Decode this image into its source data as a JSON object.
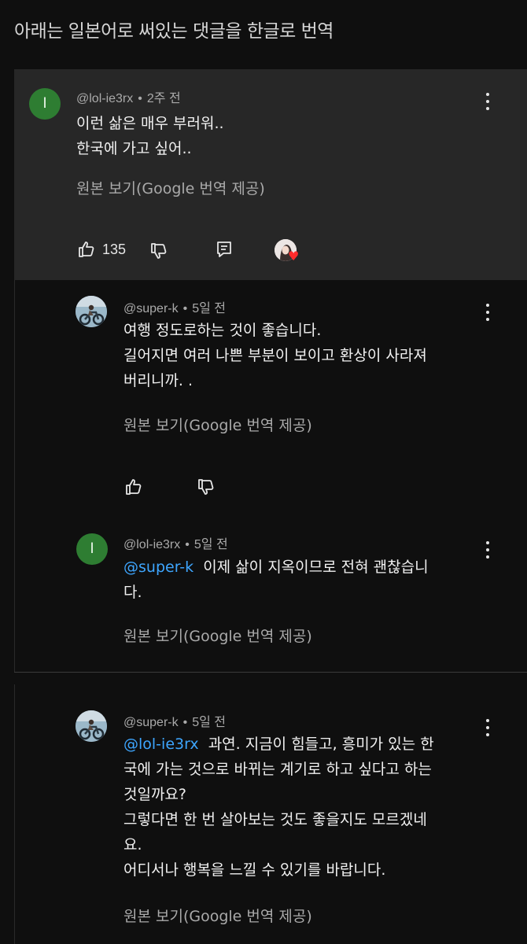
{
  "page": {
    "title": "아래는 일본어로 써있는 댓글을 한글로 번역"
  },
  "comments": [
    {
      "avatar_letter": "I",
      "handle": "@lol-ie3rx",
      "time": "2주 전",
      "lines": [
        "이런 삶은 매우 부러워..",
        "한국에 가고 싶어.."
      ],
      "translate_label": "원본 보기(Google 번역 제공)",
      "likes": "135"
    },
    {
      "handle": "@super-k",
      "time": "5일 전",
      "lines": [
        "여행 정도로하는 것이 좋습니다.",
        "길어지면 여러 나쁜 부분이 보이고 환상이 사라져",
        "버리니까. ."
      ],
      "translate_label": "원본 보기(Google 번역 제공)"
    },
    {
      "avatar_letter": "I",
      "handle": "@lol-ie3rx",
      "time": "5일 전",
      "mention": "@super-k",
      "line1": "이제 삶이 지옥이므로 전혀 괜찮습니",
      "line2": "다.",
      "translate_label": "원본 보기(Google 번역 제공)"
    },
    {
      "handle": "@super-k",
      "time": "5일 전",
      "mention": "@lol-ie3rx",
      "line1": "과연. 지금이 힘들고, 흥미가 있는 한",
      "lines": [
        "국에 가는 것으로 바뀌는 계기로 하고 싶다고 하는",
        "것일까요?",
        "그렇다면 한 번 살아보는 것도 좋을지도 모르겠네",
        "요.",
        "어디서나 행복을 느낄 수 있기를 바랍니다."
      ],
      "translate_label": "원본 보기(Google 번역 제공)"
    }
  ],
  "colors": {
    "accent": "#3ea6ff",
    "avatar_green": "#2e7d32",
    "heart": "#ff2b2b"
  }
}
